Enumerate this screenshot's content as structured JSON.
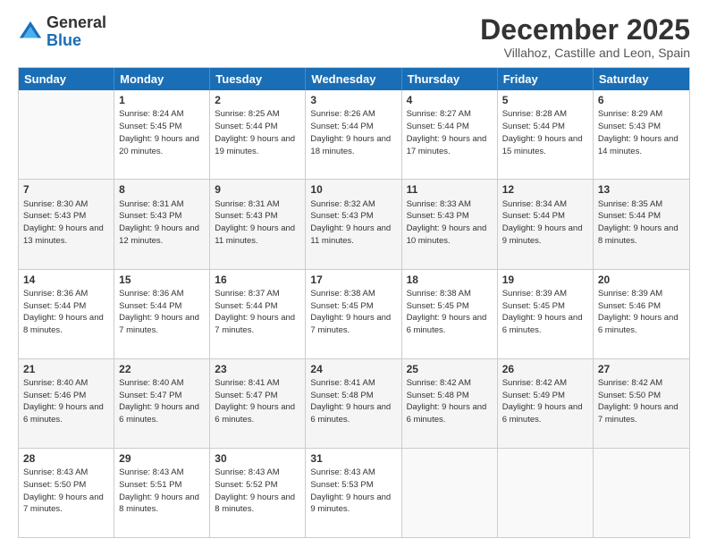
{
  "logo": {
    "general": "General",
    "blue": "Blue"
  },
  "header": {
    "month": "December 2025",
    "location": "Villahoz, Castille and Leon, Spain"
  },
  "weekdays": [
    "Sunday",
    "Monday",
    "Tuesday",
    "Wednesday",
    "Thursday",
    "Friday",
    "Saturday"
  ],
  "rows": [
    [
      {
        "day": "",
        "sunrise": "",
        "sunset": "",
        "daylight": ""
      },
      {
        "day": "1",
        "sunrise": "Sunrise: 8:24 AM",
        "sunset": "Sunset: 5:45 PM",
        "daylight": "Daylight: 9 hours and 20 minutes."
      },
      {
        "day": "2",
        "sunrise": "Sunrise: 8:25 AM",
        "sunset": "Sunset: 5:44 PM",
        "daylight": "Daylight: 9 hours and 19 minutes."
      },
      {
        "day": "3",
        "sunrise": "Sunrise: 8:26 AM",
        "sunset": "Sunset: 5:44 PM",
        "daylight": "Daylight: 9 hours and 18 minutes."
      },
      {
        "day": "4",
        "sunrise": "Sunrise: 8:27 AM",
        "sunset": "Sunset: 5:44 PM",
        "daylight": "Daylight: 9 hours and 17 minutes."
      },
      {
        "day": "5",
        "sunrise": "Sunrise: 8:28 AM",
        "sunset": "Sunset: 5:44 PM",
        "daylight": "Daylight: 9 hours and 15 minutes."
      },
      {
        "day": "6",
        "sunrise": "Sunrise: 8:29 AM",
        "sunset": "Sunset: 5:43 PM",
        "daylight": "Daylight: 9 hours and 14 minutes."
      }
    ],
    [
      {
        "day": "7",
        "sunrise": "Sunrise: 8:30 AM",
        "sunset": "Sunset: 5:43 PM",
        "daylight": "Daylight: 9 hours and 13 minutes."
      },
      {
        "day": "8",
        "sunrise": "Sunrise: 8:31 AM",
        "sunset": "Sunset: 5:43 PM",
        "daylight": "Daylight: 9 hours and 12 minutes."
      },
      {
        "day": "9",
        "sunrise": "Sunrise: 8:31 AM",
        "sunset": "Sunset: 5:43 PM",
        "daylight": "Daylight: 9 hours and 11 minutes."
      },
      {
        "day": "10",
        "sunrise": "Sunrise: 8:32 AM",
        "sunset": "Sunset: 5:43 PM",
        "daylight": "Daylight: 9 hours and 11 minutes."
      },
      {
        "day": "11",
        "sunrise": "Sunrise: 8:33 AM",
        "sunset": "Sunset: 5:43 PM",
        "daylight": "Daylight: 9 hours and 10 minutes."
      },
      {
        "day": "12",
        "sunrise": "Sunrise: 8:34 AM",
        "sunset": "Sunset: 5:44 PM",
        "daylight": "Daylight: 9 hours and 9 minutes."
      },
      {
        "day": "13",
        "sunrise": "Sunrise: 8:35 AM",
        "sunset": "Sunset: 5:44 PM",
        "daylight": "Daylight: 9 hours and 8 minutes."
      }
    ],
    [
      {
        "day": "14",
        "sunrise": "Sunrise: 8:36 AM",
        "sunset": "Sunset: 5:44 PM",
        "daylight": "Daylight: 9 hours and 8 minutes."
      },
      {
        "day": "15",
        "sunrise": "Sunrise: 8:36 AM",
        "sunset": "Sunset: 5:44 PM",
        "daylight": "Daylight: 9 hours and 7 minutes."
      },
      {
        "day": "16",
        "sunrise": "Sunrise: 8:37 AM",
        "sunset": "Sunset: 5:44 PM",
        "daylight": "Daylight: 9 hours and 7 minutes."
      },
      {
        "day": "17",
        "sunrise": "Sunrise: 8:38 AM",
        "sunset": "Sunset: 5:45 PM",
        "daylight": "Daylight: 9 hours and 7 minutes."
      },
      {
        "day": "18",
        "sunrise": "Sunrise: 8:38 AM",
        "sunset": "Sunset: 5:45 PM",
        "daylight": "Daylight: 9 hours and 6 minutes."
      },
      {
        "day": "19",
        "sunrise": "Sunrise: 8:39 AM",
        "sunset": "Sunset: 5:45 PM",
        "daylight": "Daylight: 9 hours and 6 minutes."
      },
      {
        "day": "20",
        "sunrise": "Sunrise: 8:39 AM",
        "sunset": "Sunset: 5:46 PM",
        "daylight": "Daylight: 9 hours and 6 minutes."
      }
    ],
    [
      {
        "day": "21",
        "sunrise": "Sunrise: 8:40 AM",
        "sunset": "Sunset: 5:46 PM",
        "daylight": "Daylight: 9 hours and 6 minutes."
      },
      {
        "day": "22",
        "sunrise": "Sunrise: 8:40 AM",
        "sunset": "Sunset: 5:47 PM",
        "daylight": "Daylight: 9 hours and 6 minutes."
      },
      {
        "day": "23",
        "sunrise": "Sunrise: 8:41 AM",
        "sunset": "Sunset: 5:47 PM",
        "daylight": "Daylight: 9 hours and 6 minutes."
      },
      {
        "day": "24",
        "sunrise": "Sunrise: 8:41 AM",
        "sunset": "Sunset: 5:48 PM",
        "daylight": "Daylight: 9 hours and 6 minutes."
      },
      {
        "day": "25",
        "sunrise": "Sunrise: 8:42 AM",
        "sunset": "Sunset: 5:48 PM",
        "daylight": "Daylight: 9 hours and 6 minutes."
      },
      {
        "day": "26",
        "sunrise": "Sunrise: 8:42 AM",
        "sunset": "Sunset: 5:49 PM",
        "daylight": "Daylight: 9 hours and 6 minutes."
      },
      {
        "day": "27",
        "sunrise": "Sunrise: 8:42 AM",
        "sunset": "Sunset: 5:50 PM",
        "daylight": "Daylight: 9 hours and 7 minutes."
      }
    ],
    [
      {
        "day": "28",
        "sunrise": "Sunrise: 8:43 AM",
        "sunset": "Sunset: 5:50 PM",
        "daylight": "Daylight: 9 hours and 7 minutes."
      },
      {
        "day": "29",
        "sunrise": "Sunrise: 8:43 AM",
        "sunset": "Sunset: 5:51 PM",
        "daylight": "Daylight: 9 hours and 8 minutes."
      },
      {
        "day": "30",
        "sunrise": "Sunrise: 8:43 AM",
        "sunset": "Sunset: 5:52 PM",
        "daylight": "Daylight: 9 hours and 8 minutes."
      },
      {
        "day": "31",
        "sunrise": "Sunrise: 8:43 AM",
        "sunset": "Sunset: 5:53 PM",
        "daylight": "Daylight: 9 hours and 9 minutes."
      },
      {
        "day": "",
        "sunrise": "",
        "sunset": "",
        "daylight": ""
      },
      {
        "day": "",
        "sunrise": "",
        "sunset": "",
        "daylight": ""
      },
      {
        "day": "",
        "sunrise": "",
        "sunset": "",
        "daylight": ""
      }
    ]
  ]
}
